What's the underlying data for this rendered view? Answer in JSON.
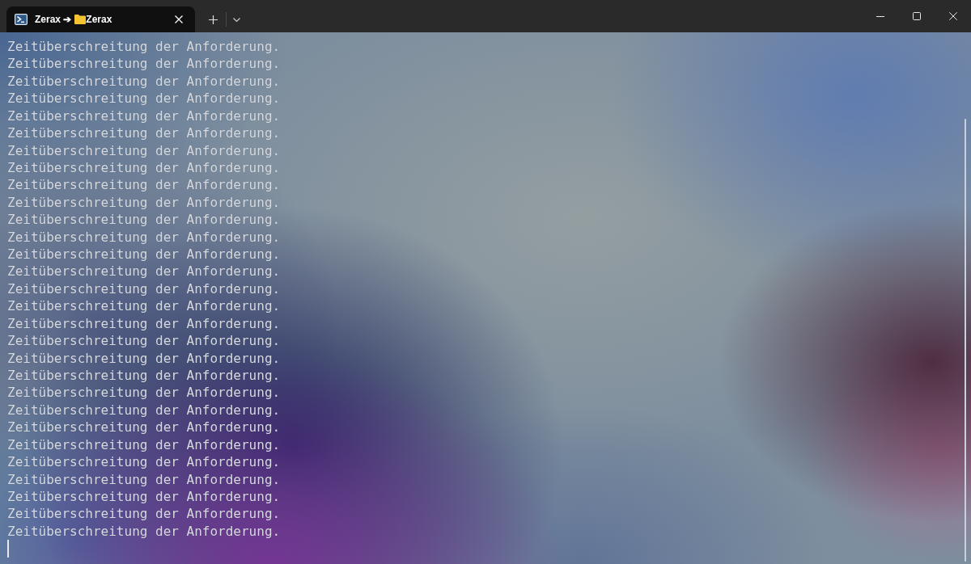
{
  "window": {
    "tab": {
      "title_start": "Zerax ➔",
      "title_end": "Zerax"
    }
  },
  "terminal": {
    "lines": [
      "Zeitüberschreitung der Anforderung.",
      "Zeitüberschreitung der Anforderung.",
      "Zeitüberschreitung der Anforderung.",
      "Zeitüberschreitung der Anforderung.",
      "Zeitüberschreitung der Anforderung.",
      "Zeitüberschreitung der Anforderung.",
      "Zeitüberschreitung der Anforderung.",
      "Zeitüberschreitung der Anforderung.",
      "Zeitüberschreitung der Anforderung.",
      "Zeitüberschreitung der Anforderung.",
      "Zeitüberschreitung der Anforderung.",
      "Zeitüberschreitung der Anforderung.",
      "Zeitüberschreitung der Anforderung.",
      "Zeitüberschreitung der Anforderung.",
      "Zeitüberschreitung der Anforderung.",
      "Zeitüberschreitung der Anforderung.",
      "Zeitüberschreitung der Anforderung.",
      "Zeitüberschreitung der Anforderung.",
      "Zeitüberschreitung der Anforderung.",
      "Zeitüberschreitung der Anforderung.",
      "Zeitüberschreitung der Anforderung.",
      "Zeitüberschreitung der Anforderung.",
      "Zeitüberschreitung der Anforderung.",
      "Zeitüberschreitung der Anforderung.",
      "Zeitüberschreitung der Anforderung.",
      "Zeitüberschreitung der Anforderung.",
      "Zeitüberschreitung der Anforderung.",
      "Zeitüberschreitung der Anforderung.",
      "Zeitüberschreitung der Anforderung."
    ]
  }
}
